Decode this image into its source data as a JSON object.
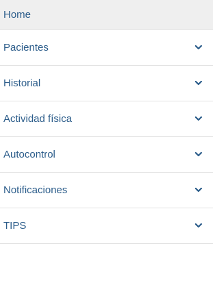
{
  "sidebar": {
    "link_color": "#2b5c8a",
    "active_bg": "#efefef",
    "items": [
      {
        "label": "Home",
        "active": true,
        "has_submenu": false
      },
      {
        "label": "Pacientes",
        "active": false,
        "has_submenu": true,
        "icon": "chevron-down-icon"
      },
      {
        "label": "Historial",
        "active": false,
        "has_submenu": true,
        "icon": "chevron-down-icon"
      },
      {
        "label": "Actividad física",
        "active": false,
        "has_submenu": true,
        "icon": "chevron-down-icon"
      },
      {
        "label": "Autocontrol",
        "active": false,
        "has_submenu": true,
        "icon": "chevron-down-icon"
      },
      {
        "label": "Notificaciones",
        "active": false,
        "has_submenu": true,
        "icon": "chevron-down-icon"
      },
      {
        "label": "TIPS",
        "active": false,
        "has_submenu": true,
        "icon": "chevron-down-icon"
      }
    ]
  }
}
